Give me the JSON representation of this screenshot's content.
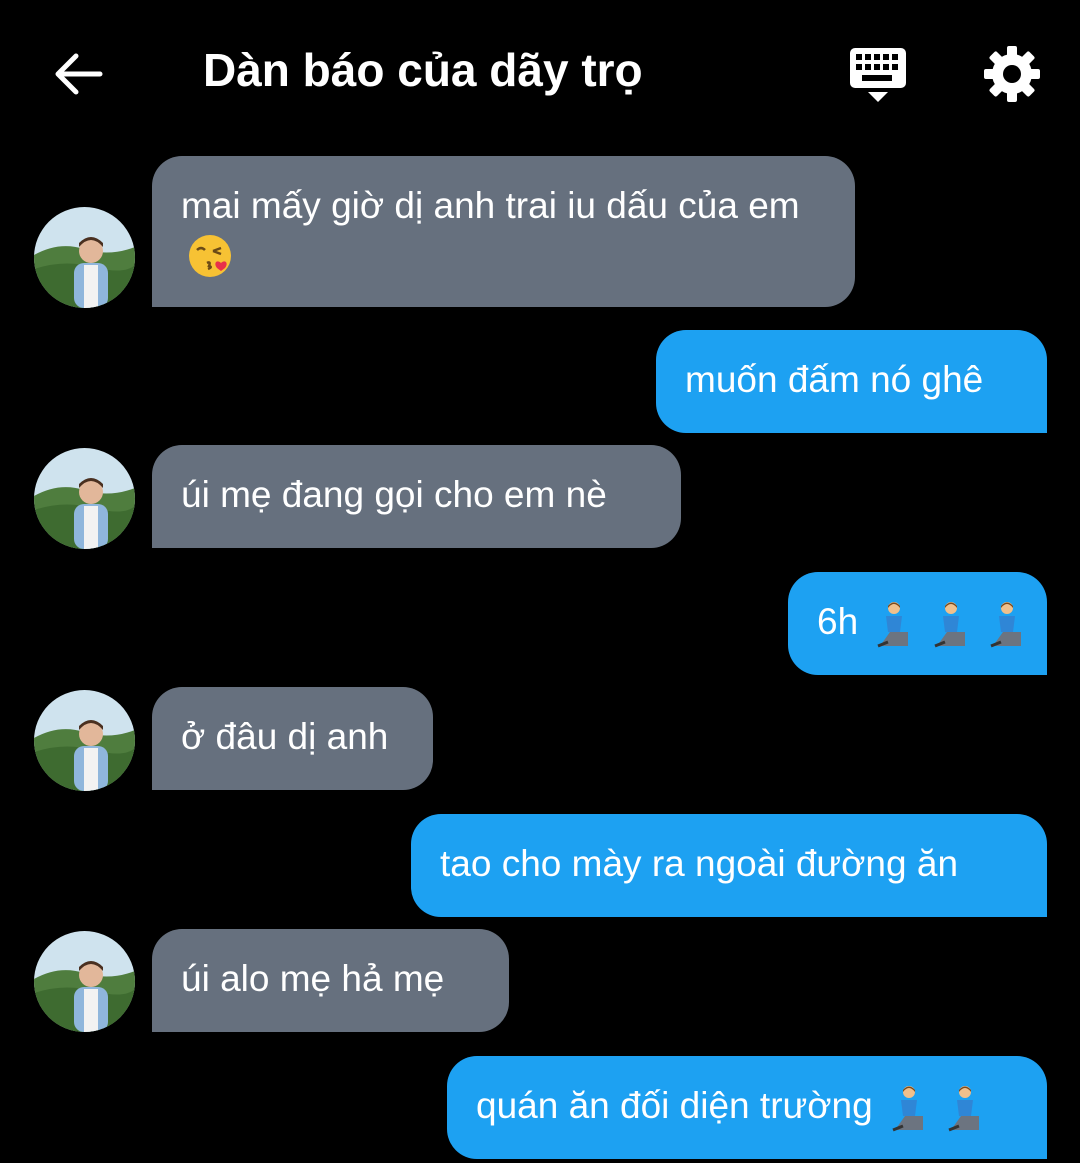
{
  "header": {
    "title": "Dàn báo của dãy trọ",
    "back_icon": "arrow-left-icon",
    "keyboard_icon": "keyboard-icon",
    "settings_icon": "gear-icon"
  },
  "colors": {
    "background": "#000000",
    "incoming_bubble": "#66707e",
    "outgoing_bubble": "#1da1f2",
    "text": "#ffffff"
  },
  "messages": [
    {
      "direction": "incoming",
      "text": "mai mấy giờ dị anh trai iu dấu của em",
      "emoji": "kissing-face-emoji"
    },
    {
      "direction": "outgoing",
      "text": "muốn đấm nó ghê"
    },
    {
      "direction": "incoming",
      "text": "úi mẹ đang gọi cho em nè"
    },
    {
      "direction": "outgoing",
      "text": "6h",
      "emoji": "kneeling-person-emoji x3"
    },
    {
      "direction": "incoming",
      "text": "ở đâu dị anh"
    },
    {
      "direction": "outgoing",
      "text": "tao cho mày ra ngoài đường ăn"
    },
    {
      "direction": "incoming",
      "text": "úi alo mẹ hả mẹ"
    },
    {
      "direction": "outgoing",
      "text": "quán ăn đối diện trường",
      "emoji": "kneeling-person-emoji x2"
    }
  ]
}
